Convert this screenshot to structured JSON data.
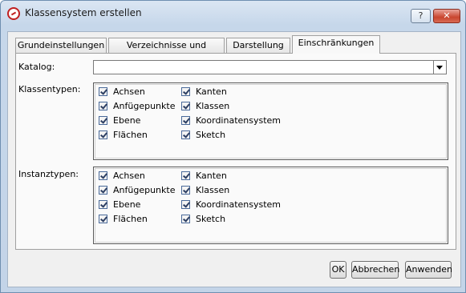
{
  "window": {
    "title": "Klassensystem erstellen",
    "help_label": "?",
    "close_label": "✕"
  },
  "tabs": [
    {
      "label": "Grundeinstellungen",
      "active": false
    },
    {
      "label": "Verzeichnisse und Dateien",
      "active": false
    },
    {
      "label": "Darstellung",
      "active": false
    },
    {
      "label": "Einschränkungen",
      "active": true
    }
  ],
  "katalog": {
    "label": "Katalog:",
    "value": ""
  },
  "klassentypen": {
    "label": "Klassentypen:",
    "col1": [
      {
        "label": "Achsen",
        "checked": true
      },
      {
        "label": "Anfügepunkte",
        "checked": true
      },
      {
        "label": "Ebene",
        "checked": true
      },
      {
        "label": "Flächen",
        "checked": true
      }
    ],
    "col2": [
      {
        "label": "Kanten",
        "checked": true
      },
      {
        "label": "Klassen",
        "checked": true
      },
      {
        "label": "Koordinatensystem",
        "checked": true
      },
      {
        "label": "Sketch",
        "checked": true
      }
    ]
  },
  "instanztypen": {
    "label": "Instanztypen:",
    "col1": [
      {
        "label": "Achsen",
        "checked": true
      },
      {
        "label": "Anfügepunkte",
        "checked": true
      },
      {
        "label": "Ebene",
        "checked": true
      },
      {
        "label": "Flächen",
        "checked": true
      }
    ],
    "col2": [
      {
        "label": "Kanten",
        "checked": true
      },
      {
        "label": "Klassen",
        "checked": true
      },
      {
        "label": "Koordinatensystem",
        "checked": true
      },
      {
        "label": "Sketch",
        "checked": true
      }
    ]
  },
  "buttons": {
    "ok": "OK",
    "cancel": "Abbrechen",
    "apply": "Anwenden"
  }
}
